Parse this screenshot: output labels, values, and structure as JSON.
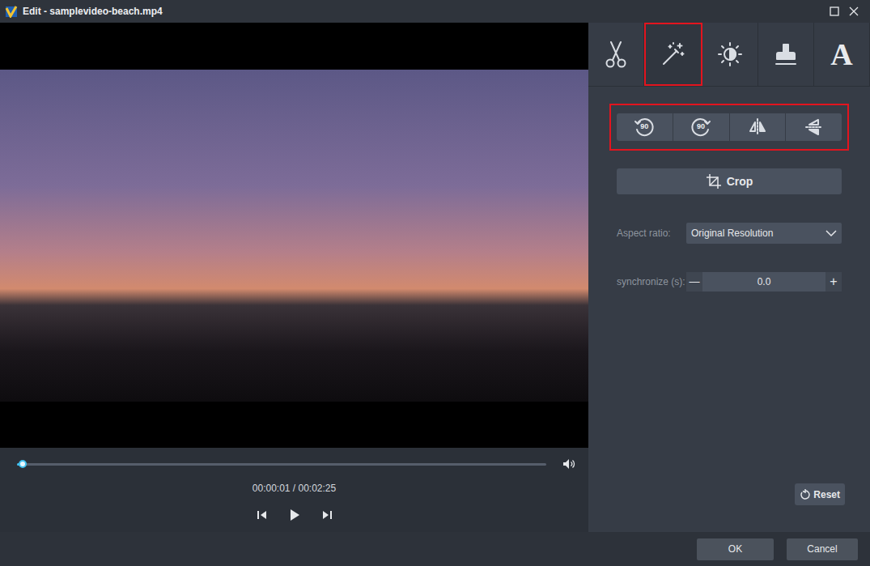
{
  "window": {
    "title": "Edit - samplevideo-beach.mp4"
  },
  "video": {
    "progress": {
      "level": 0.01
    },
    "time": "00:00:01 / 00:02:25"
  },
  "tabs": [
    {
      "kind": "cut",
      "selected": false
    },
    {
      "kind": "effect",
      "selected": true
    },
    {
      "kind": "adjust",
      "selected": false
    },
    {
      "kind": "watermark",
      "selected": false
    },
    {
      "kind": "text",
      "label": "A",
      "selected": false
    }
  ],
  "transform": {
    "highlighted": true,
    "buttons": [
      {
        "kind": "rotate-left",
        "label": "90"
      },
      {
        "kind": "rotate-right",
        "label": "90"
      },
      {
        "kind": "flip-horizontal"
      },
      {
        "kind": "flip-vertical"
      }
    ]
  },
  "crop": {
    "label": "Crop"
  },
  "aspect_ratio": {
    "label": "Aspect ratio:",
    "value": "Original Resolution"
  },
  "synchronize": {
    "label": "synchronize (s):",
    "decrement": "—",
    "value": "0.0",
    "increment": "+"
  },
  "reset": {
    "label": "Reset"
  },
  "buttons": [
    "OK",
    "Cancel"
  ]
}
